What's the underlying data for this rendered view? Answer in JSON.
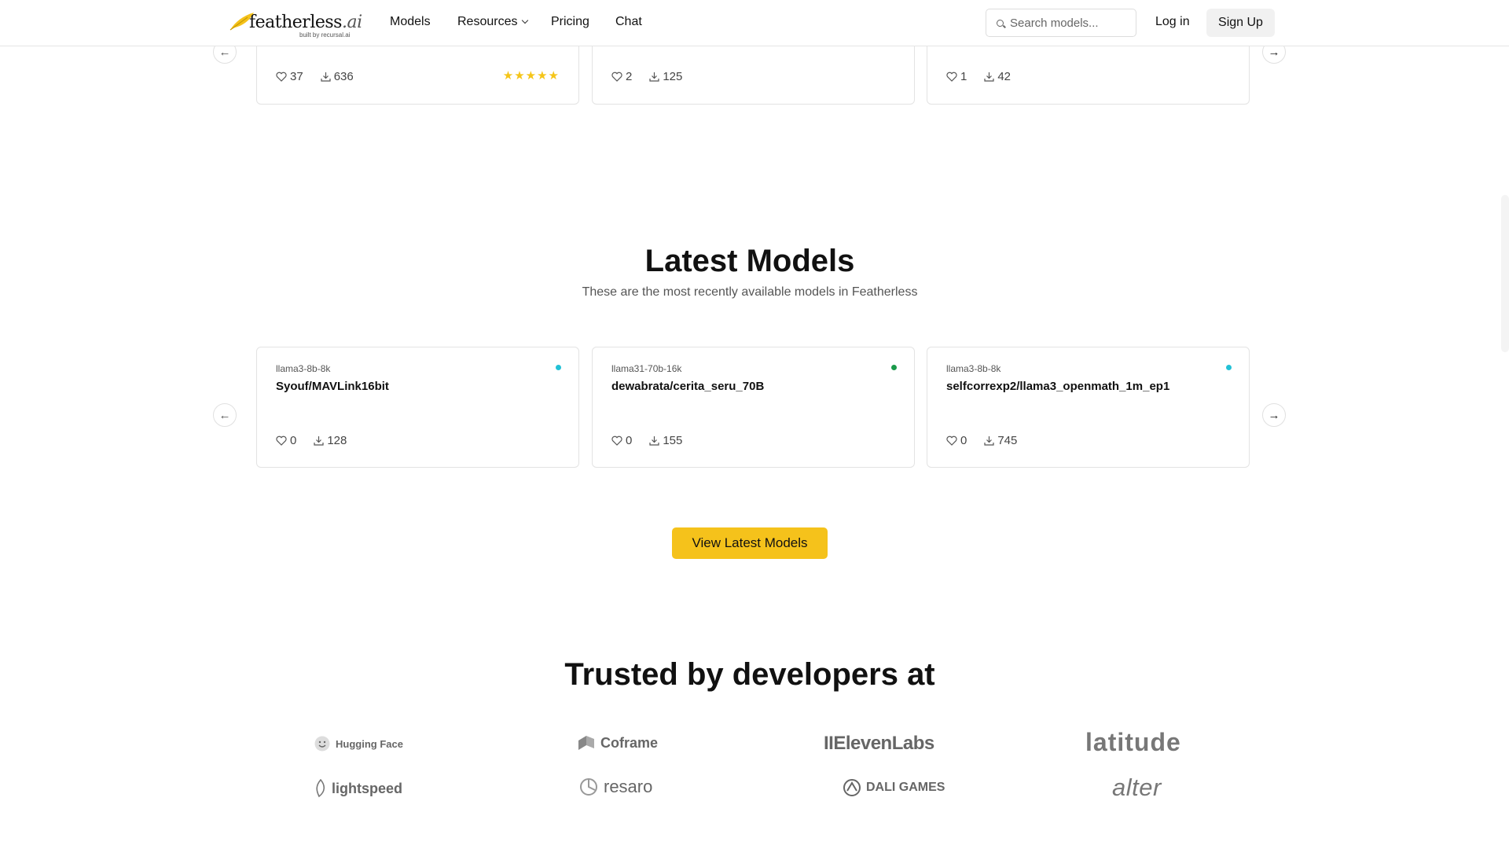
{
  "nav": {
    "logo_text": "featherless",
    "logo_suffix": ".ai",
    "logo_sub": "built by recursal.ai",
    "links": [
      "Models",
      "Resources",
      "Pricing",
      "Chat"
    ],
    "search_placeholder": "Search models...",
    "login": "Log in",
    "signup": "Sign Up"
  },
  "top_cards": [
    {
      "likes": "37",
      "downloads": "636",
      "stars": "★★★★★"
    },
    {
      "likes": "2",
      "downloads": "125"
    },
    {
      "likes": "1",
      "downloads": "42"
    }
  ],
  "latest": {
    "title": "Latest Models",
    "subtitle": "These are the most recently available models in Featherless",
    "cards": [
      {
        "tag": "llama3-8b-8k",
        "name": "Syouf/MAVLink16bit",
        "likes": "0",
        "downloads": "128",
        "dot_color": "#22c1d6"
      },
      {
        "tag": "llama31-70b-16k",
        "name": "dewabrata/cerita_seru_70B",
        "likes": "0",
        "downloads": "155",
        "dot_color": "#1a9a4a"
      },
      {
        "tag": "llama3-8b-8k",
        "name": "selfcorrexp2/llama3_openmath_1m_ep1",
        "likes": "0",
        "downloads": "745",
        "dot_color": "#22c1d6"
      }
    ],
    "cta": "View Latest Models"
  },
  "trusted": {
    "title": "Trusted by developers at",
    "brands": [
      "Hugging Face",
      "Coframe",
      "IIElevenLabs",
      "latitude",
      "lightspeed",
      "resaro",
      "DALI GAMES",
      "alter"
    ]
  },
  "colors": {
    "accent": "#f5c21b",
    "star": "#f5c518"
  }
}
